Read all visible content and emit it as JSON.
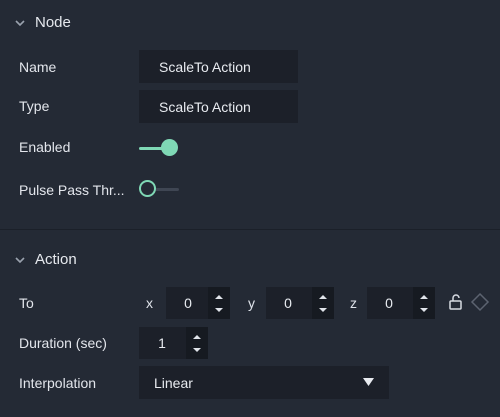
{
  "colors": {
    "background": "#242a35",
    "field": "#1c2029",
    "accent": "#7fd8b5",
    "muted": "#8a919c"
  },
  "node": {
    "section_title": "Node",
    "name_label": "Name",
    "name_value": "ScaleTo Action",
    "type_label": "Type",
    "type_value": "ScaleTo Action",
    "enabled_label": "Enabled",
    "enabled_on": true,
    "pulse_label": "Pulse Pass Thr...",
    "pulse_on": false
  },
  "action": {
    "section_title": "Action",
    "to_label": "To",
    "x_label": "x",
    "x_value": "0",
    "y_label": "y",
    "y_value": "0",
    "z_label": "z",
    "z_value": "0",
    "duration_label": "Duration (sec)",
    "duration_value": "1",
    "interpolation_label": "Interpolation",
    "interpolation_value": "Linear"
  },
  "icons": [
    "chevron-down-icon",
    "unlock-icon",
    "diamond-icon",
    "caret-up-icon",
    "caret-down-icon",
    "dropdown-arrow-icon"
  ]
}
